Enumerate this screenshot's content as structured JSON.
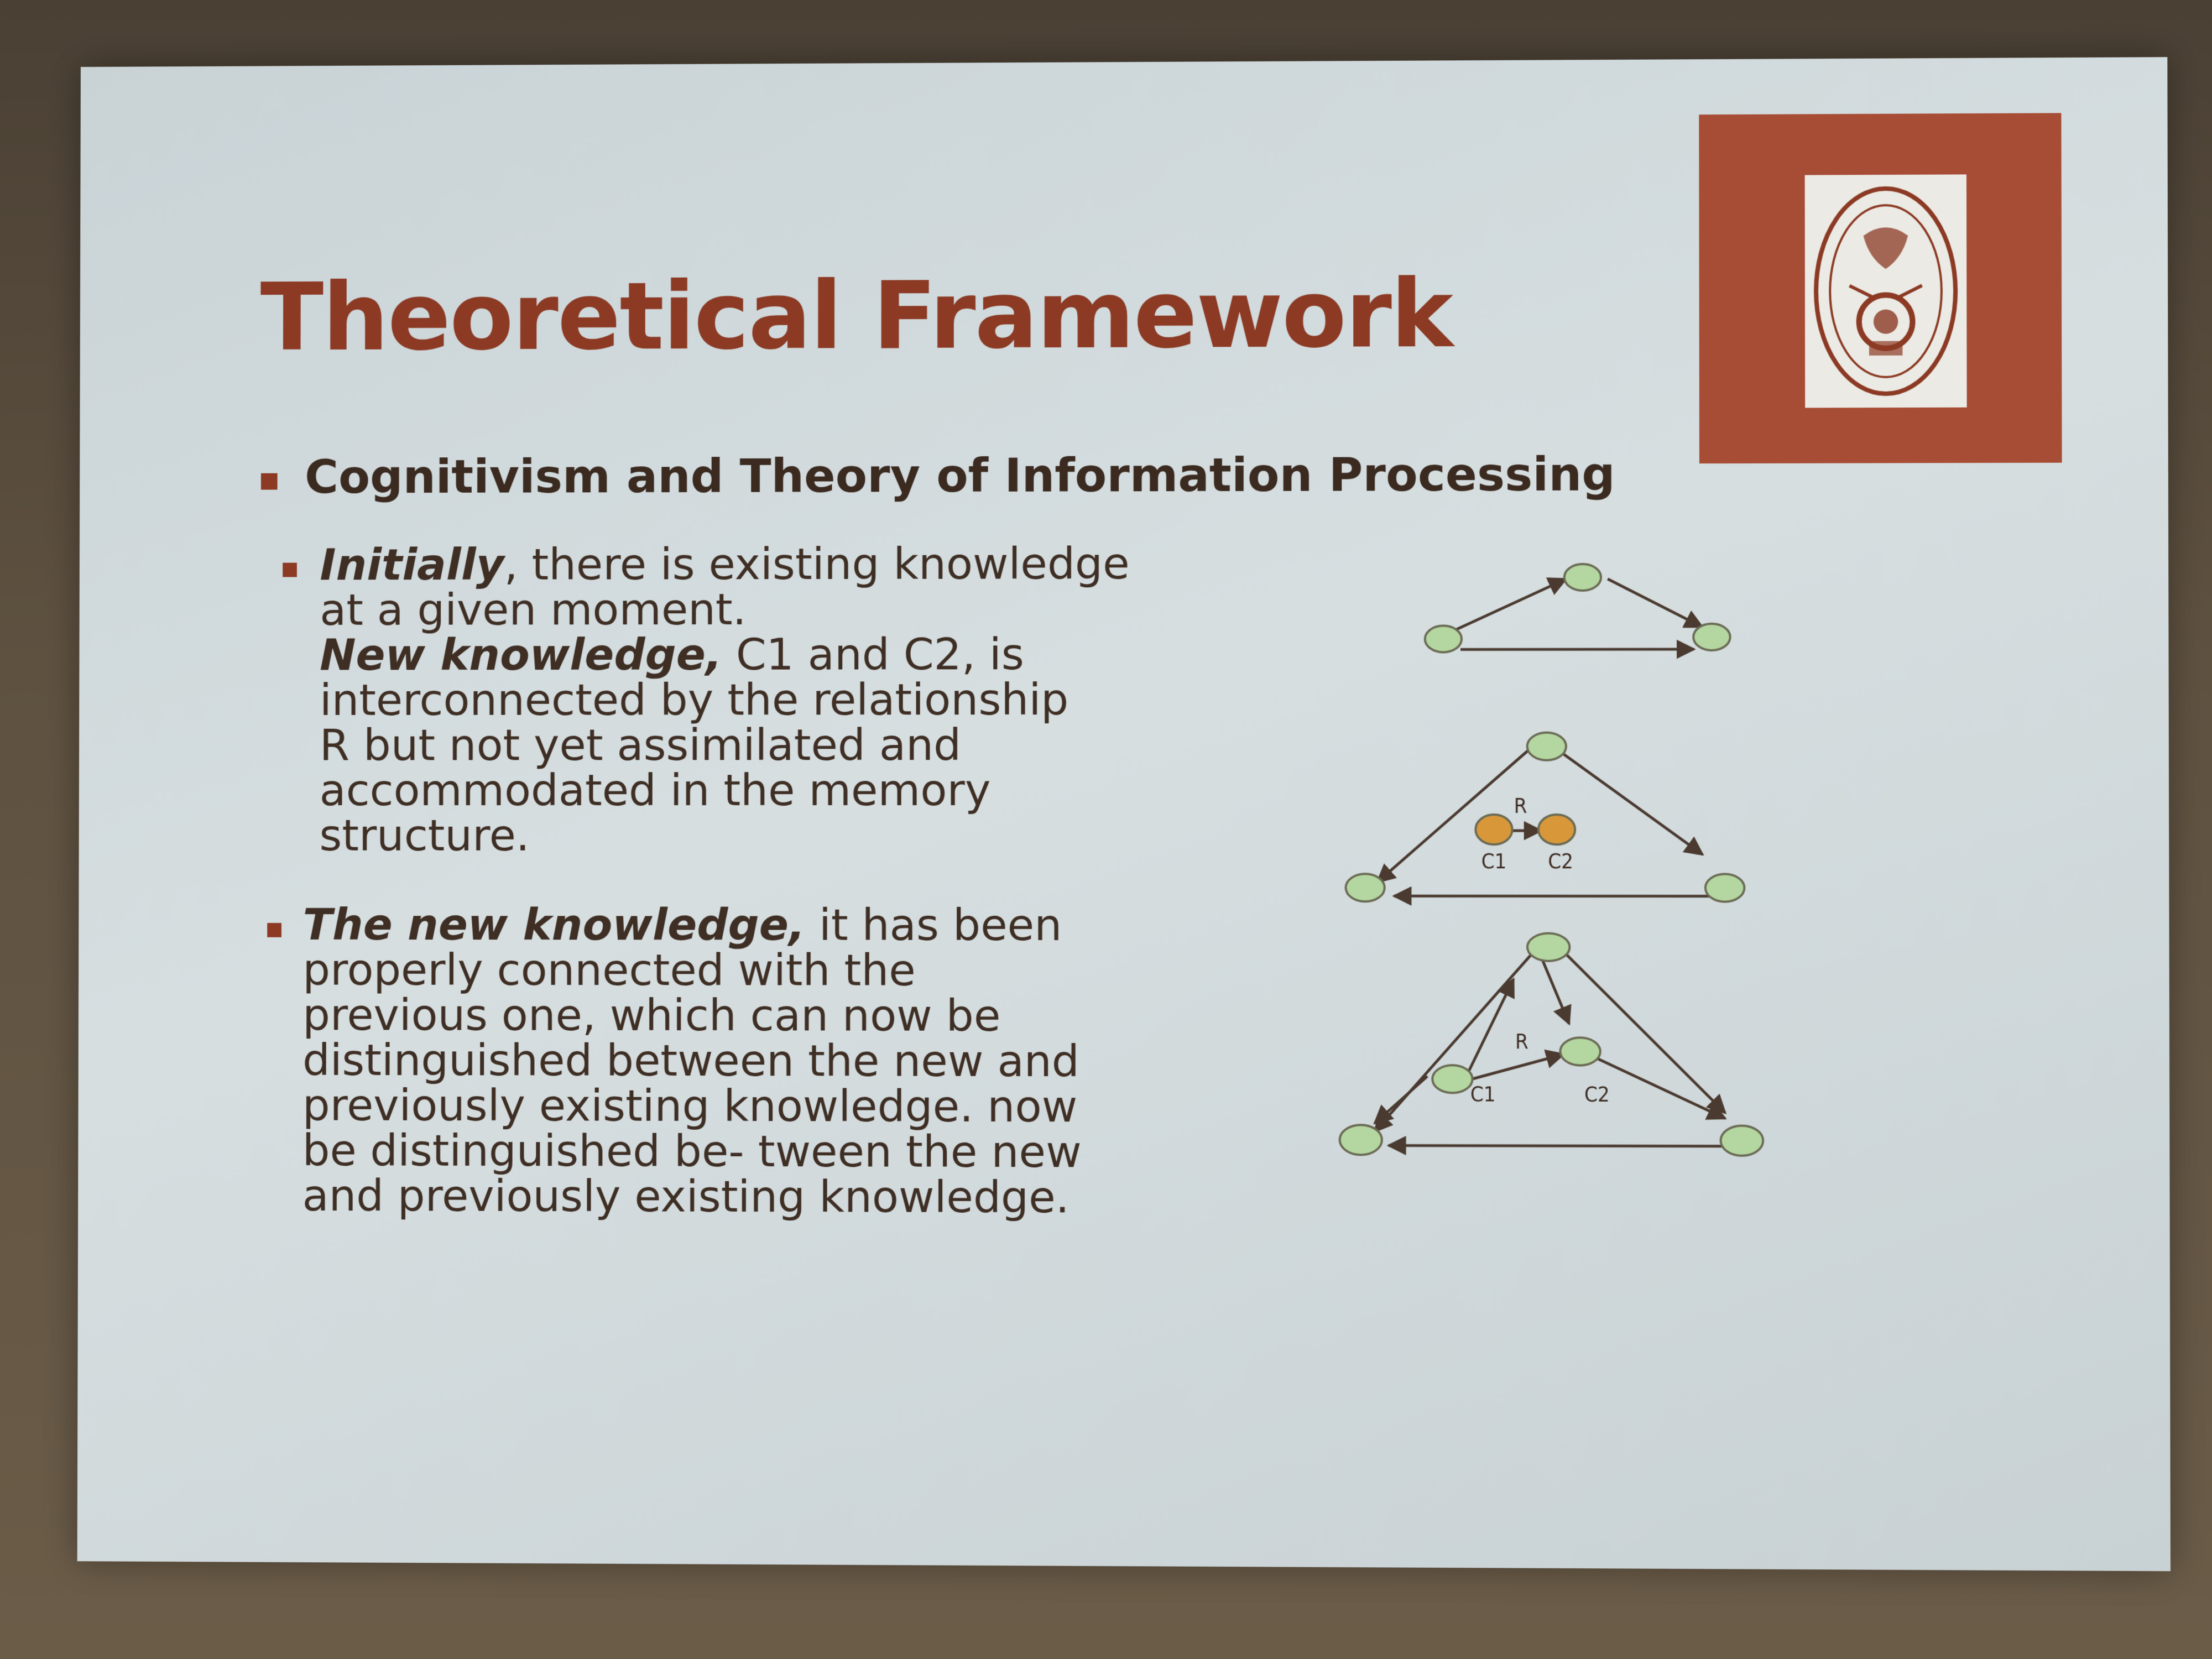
{
  "slide": {
    "title": "Theoretical Framework",
    "subtitle": "Cognitivism and Theory of Information Processing",
    "bullet1": {
      "em1": "Initially",
      "l1_rest": ", there is existing knowledge",
      "l2": "at a given moment.",
      "em2": "New knowledge,",
      "l3_rest": " C1 and C2, is",
      "l4": "interconnected by the relationship",
      "l5": "R but not yet assimilated and",
      "l6": "accommodated in the memory",
      "l7": "structure."
    },
    "bullet2": {
      "em1": "The new knowledge,",
      "l1_rest": " it has been",
      "l2": "properly connected with the",
      "l3": "previous one, which can now be",
      "l4": "distinguished between the new and",
      "l5": "previously existing knowledge. now",
      "l6": "be distinguished be- tween the new",
      "l7": "and previously existing knowledge."
    },
    "diagram": {
      "relation_label": "R",
      "c1_label": "C1",
      "c2_label": "C2"
    },
    "colors": {
      "title": "#8c3a24",
      "logo_frame": "#a74c35",
      "node_green": "#b4d6a0",
      "node_orange": "#d8983a"
    }
  }
}
